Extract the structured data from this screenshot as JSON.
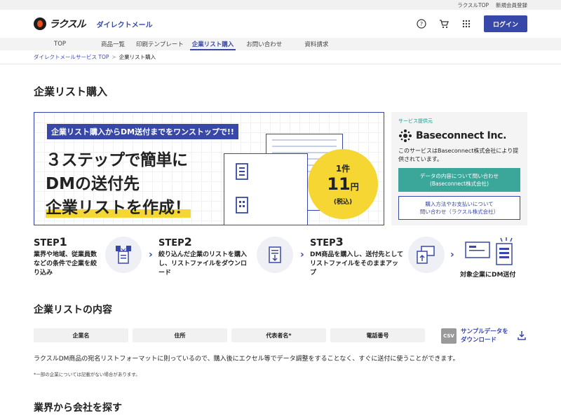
{
  "util": {
    "links": [
      "ラクスルTOP",
      "新規会員登録"
    ]
  },
  "header": {
    "logo_text": "ラクスル",
    "service_name": "ダイレクトメール",
    "login_label": "ログイン",
    "icons": [
      "help-icon",
      "cart-icon",
      "apps-grid-icon"
    ]
  },
  "nav": {
    "items": [
      "TOP",
      "商品一覧",
      "印刷テンプレート",
      "企業リスト購入",
      "お問い合わせ",
      "資料請求"
    ],
    "active": "企業リスト購入"
  },
  "breadcrumb": {
    "parent": "ダイレクトメールサービス TOP",
    "separator": ">",
    "current": "企業リスト購入"
  },
  "page": {
    "title": "企業リスト購入"
  },
  "banner": {
    "strip": "企業リスト購入からDM送付までをワンストップで!!",
    "line1": "３ステップで簡単に",
    "line2": "DMの送付先",
    "line3": "企業リストを作成！",
    "price_prefix": "1件",
    "price_value": "11",
    "price_unit": "円",
    "price_tax": "(税込)"
  },
  "provider": {
    "tag": "サービス提供元",
    "name": "Baseconnect Inc.",
    "desc": "このサービスはBaseconnect株式会社により提供されています。",
    "btn1_line1": "データの内容について問い合わせ",
    "btn1_line2": "(Baseconnect株式会社)",
    "btn2_line1": "購入方法やお支払いについて",
    "btn2_line2": "問い合わせ（ラクスル株式会社）"
  },
  "steps": [
    {
      "label": "STEP",
      "num": "1",
      "text": "業界や地域、従業員数などの条件で企業を絞り込み"
    },
    {
      "label": "STEP",
      "num": "2",
      "text": "絞り込んだ企業のリストを購入し、リストファイルをダウンロード"
    },
    {
      "label": "STEP",
      "num": "3",
      "text": "DM商品を購入し、送付先としてリストファイルをそのままアップ"
    }
  ],
  "final_step": "対象企業にDM送付",
  "list_section": {
    "heading": "企業リストの内容",
    "fields": [
      "企業名",
      "住所",
      "代表者名*",
      "電話番号"
    ],
    "csv_badge": "CSV",
    "sample_line1": "サンプルデータを",
    "sample_line2": "ダウンロード",
    "description": "ラクスルDM商品の宛名リストフォーマットに則っているので、購入後にエクセル等でデータ調整をすることなく、すぐに送付に使うことができます。",
    "note": "*一部の企業については記載がない場合があります。"
  },
  "industry_section": {
    "heading": "業界から会社を探す"
  },
  "colors": {
    "primary": "#3848a8",
    "accent_yellow": "#f5d632",
    "teal": "#3aa79a"
  }
}
